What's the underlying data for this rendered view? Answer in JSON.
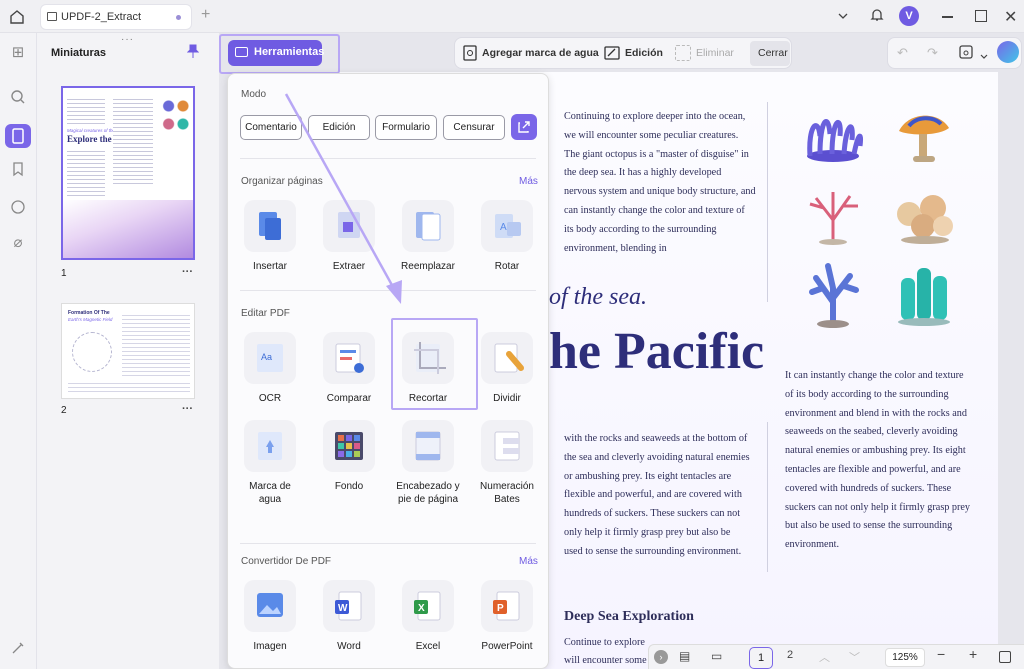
{
  "titlebar": {
    "tab_title": "UPDF-2_Extract",
    "avatar_letter": "V"
  },
  "thumbnails": {
    "title": "Miniaturas",
    "pages": [
      {
        "number": "1",
        "more": "···",
        "heading_small": "Magical creatures of the sea.",
        "heading": "Explore the Pacific"
      },
      {
        "number": "2",
        "more": "···",
        "heading": "Formation Of The",
        "subheading": "Earth's Magnetic Field"
      }
    ]
  },
  "toolbar": {
    "herramientas": "Herramientas",
    "watermark": "Agregar marca de agua",
    "edicion": "Edición",
    "eliminar": "Eliminar",
    "cerrar": "Cerrar"
  },
  "panel": {
    "modo_title": "Modo",
    "modes": [
      "Comentario",
      "Edición",
      "Formulario",
      "Censurar"
    ],
    "organizar_title": "Organizar páginas",
    "organizar_more": "Más",
    "organizar": [
      "Insertar",
      "Extraer",
      "Reemplazar",
      "Rotar"
    ],
    "editar_title": "Editar PDF",
    "editar_row1": [
      "OCR",
      "Comparar",
      "Recortar",
      "Dividir"
    ],
    "editar_row2": [
      "Marca de agua",
      "Fondo",
      "Encabezado y pie de página",
      "Numeración Bates"
    ],
    "convertidor_title": "Convertidor De PDF",
    "convertidor_more": "Más",
    "convertidor": [
      "Imagen",
      "Word",
      "Excel",
      "PowerPoint"
    ]
  },
  "document": {
    "para1": "Continuing to explore deeper into the ocean, we will encounter some peculiar creatures. The giant octopus is a \"master of disguise\" in the deep sea. It has a highly developed nervous system and unique body structure, and can instantly change the color and texture of its body according to the surrounding environment, blending in",
    "subtitle": "of the sea.",
    "title": "he Pacific",
    "para2": "with the rocks and seaweeds at the bottom of the sea and cleverly avoiding natural enemies or ambushing prey. Its eight tentacles are flexible and powerful, and are covered with hundreds of suckers. These suckers can not only help it firmly grasp prey but also be used to sense the surrounding environment.",
    "para3": "It can instantly change the color and texture of its body according to the surrounding environment and blend in with the rocks and seaweeds on the seabed, cleverly avoiding natural enemies or ambushing prey. Its eight tentacles are flexible and powerful, and are covered with hundreds of suckers. These suckers can not only help it firmly grasp prey but also be used to sense the surrounding environment.",
    "section_heading": "Deep Sea Exploration",
    "para4_line1": "Continue to explore",
    "para4_line2": "will encounter some"
  },
  "bottombar": {
    "page1": "1",
    "page2": "2",
    "zoom": "125%"
  },
  "colors": {
    "accent": "#6f5be2",
    "highlight": "#b8a7f5",
    "doc_text": "#2e2e5a"
  }
}
